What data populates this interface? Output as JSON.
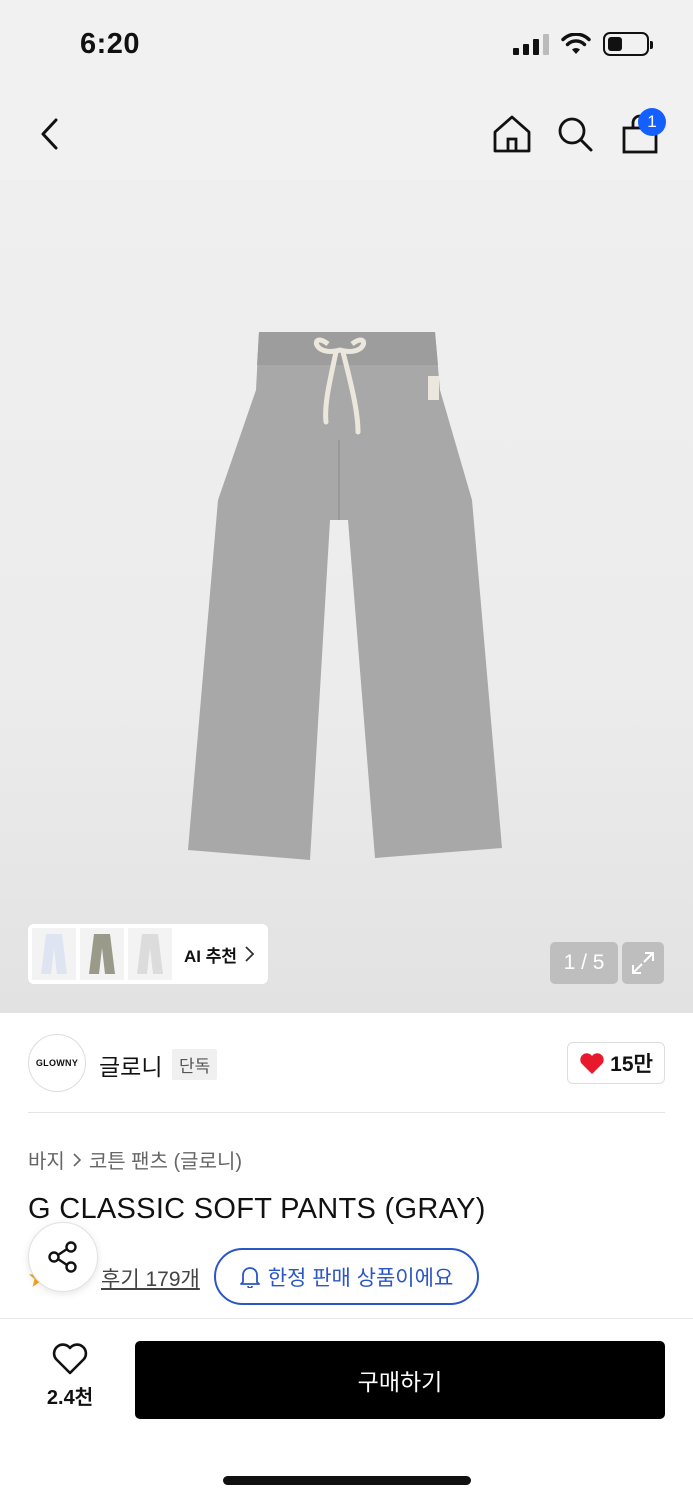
{
  "status_bar": {
    "time": "6:20"
  },
  "header": {
    "cart_count": "1"
  },
  "gallery": {
    "ai_recommend_label": "AI 추천",
    "page_indicator": "1 / 5"
  },
  "brand": {
    "logo_text": "GLOWNY",
    "name": "글로니",
    "exclusive_badge": "단독",
    "likes": "15만"
  },
  "breadcrumb": {
    "category": "바지",
    "subcategory": "코튼 팬츠 (글로니)"
  },
  "product": {
    "title": "G CLASSIC SOFT PANTS (GRAY)",
    "review_link": "후기 179개",
    "limited_label": "한정 판매 상품이에요"
  },
  "bottom_bar": {
    "wish_count": "2.4천",
    "buy_label": "구매하기"
  },
  "colors": {
    "accent": "#2a56c6",
    "badge": "#1460ff",
    "heart": "#e8192c"
  }
}
